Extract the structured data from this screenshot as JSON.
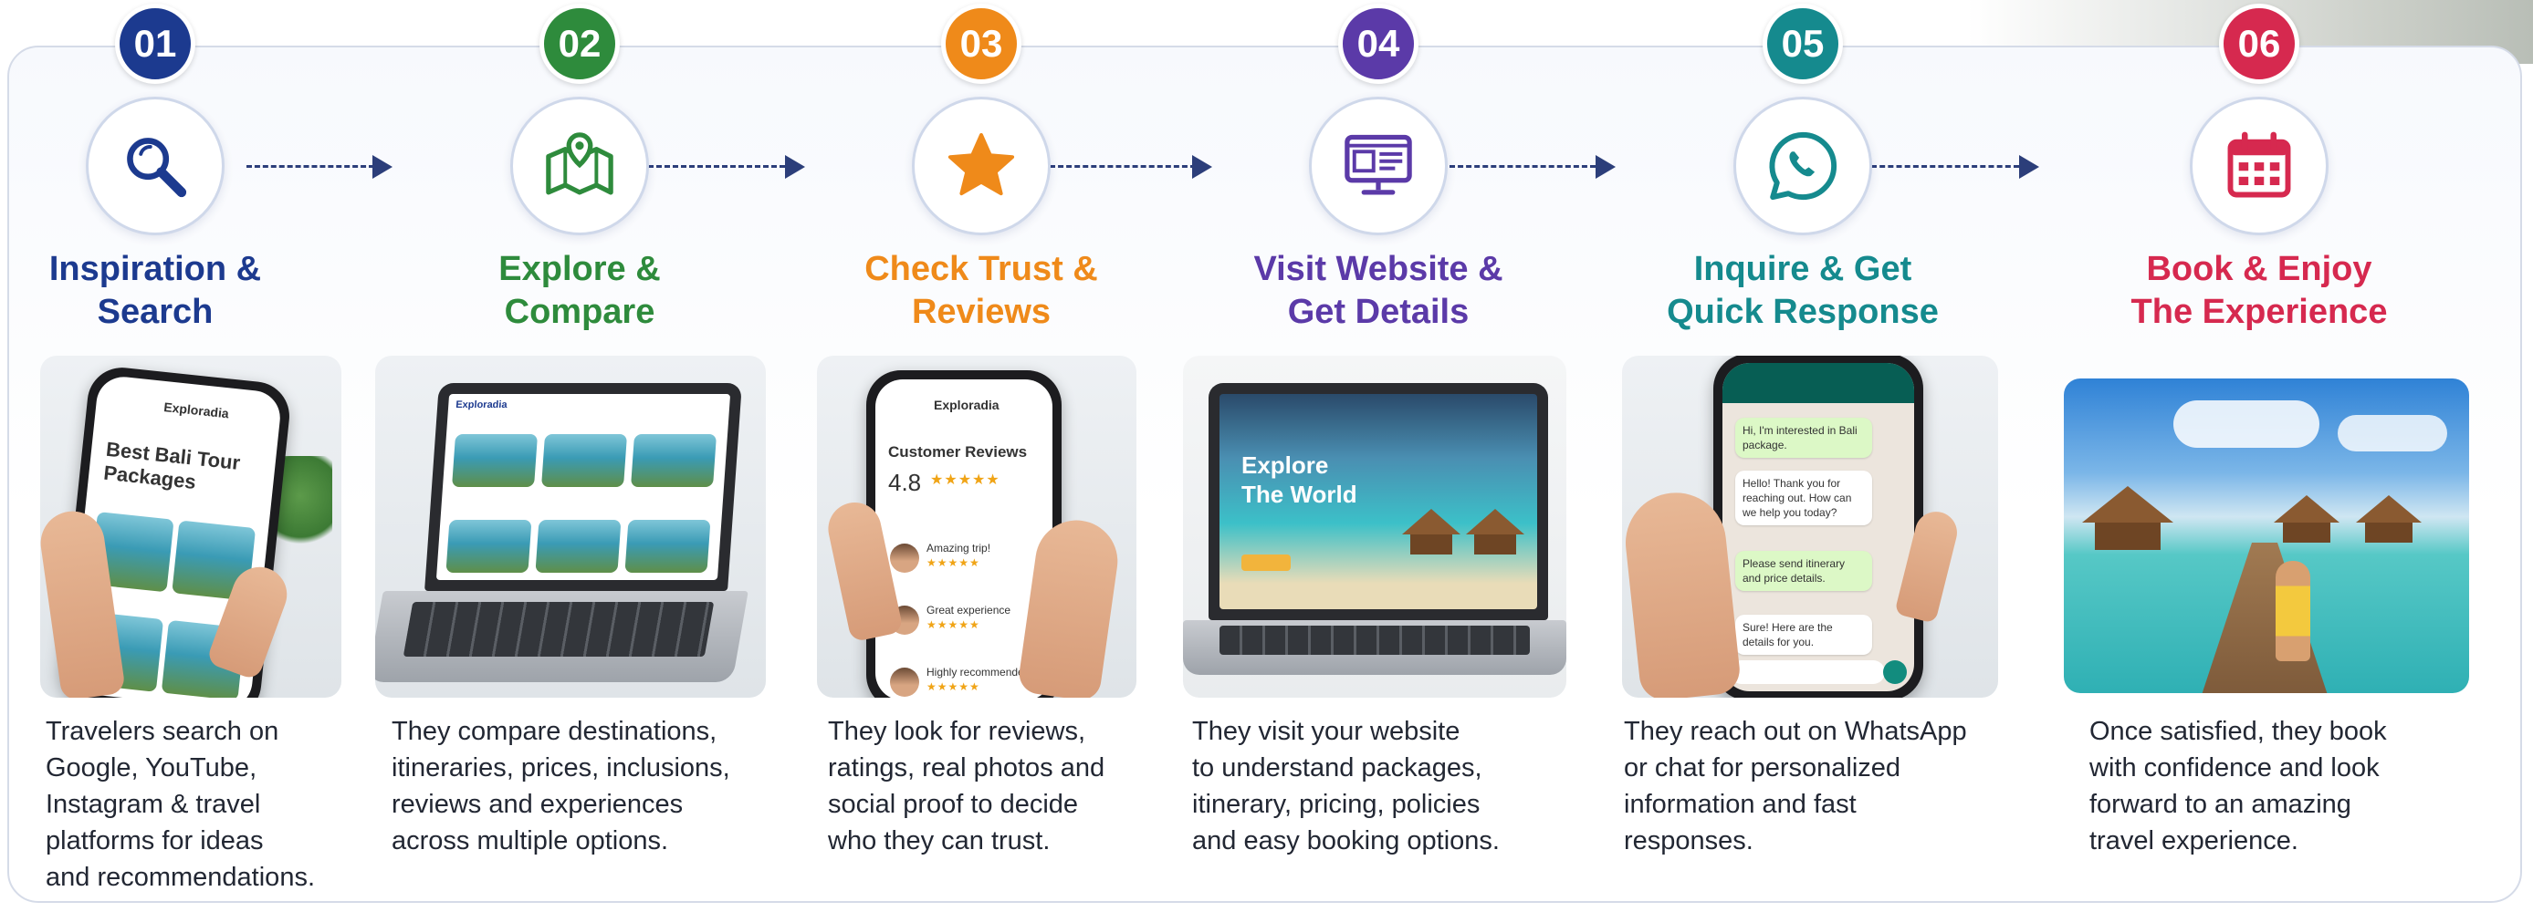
{
  "steps": [
    {
      "number": "01",
      "color": "#1c3a8f",
      "icon": "search-icon",
      "title_lines": [
        "Inspiration &",
        "Search"
      ],
      "desc_lines": [
        "Travelers search on",
        "Google, YouTube,",
        "Instagram & travel",
        "platforms for ideas",
        "and recommendations."
      ],
      "mockup": {
        "app_name": "Exploradia",
        "heading_lines": [
          "Best Bali Tour",
          "Packages"
        ]
      }
    },
    {
      "number": "02",
      "color": "#2e8b3c",
      "icon": "map-pin-icon",
      "title_lines": [
        "Explore &",
        "Compare"
      ],
      "desc_lines": [
        "They compare destinations,",
        "itineraries, prices, inclusions,",
        "reviews and experiences",
        "across multiple options."
      ],
      "mockup": {
        "app_name": "Exploradia"
      }
    },
    {
      "number": "03",
      "color": "#ef8a1a",
      "icon": "star-icon",
      "title_lines": [
        "Check Trust &",
        "Reviews"
      ],
      "desc_lines": [
        "They look for reviews,",
        "ratings, real photos and",
        "social proof to decide",
        "who they can trust."
      ],
      "mockup": {
        "app_name": "Exploradia",
        "heading": "Customer Reviews",
        "rating": "4.8",
        "reviews": [
          "Amazing trip!",
          "Great experience",
          "Highly recommended"
        ]
      }
    },
    {
      "number": "04",
      "color": "#5b3aa8",
      "icon": "website-monitor-icon",
      "title_lines": [
        "Visit Website &",
        "Get Details"
      ],
      "desc_lines": [
        "They visit your website",
        "to understand packages,",
        "itinerary, pricing, policies",
        "and easy booking options."
      ],
      "mockup": {
        "hero_lines": [
          "Explore",
          "The World"
        ]
      }
    },
    {
      "number": "05",
      "color": "#158a8e",
      "icon": "whatsapp-icon",
      "title_lines": [
        "Inquire & Get",
        "Quick Response"
      ],
      "desc_lines": [
        "They reach out on WhatsApp",
        "or chat for personalized",
        "information and fast",
        "responses."
      ],
      "mockup": {
        "messages": [
          {
            "from": "me",
            "text": "Hi, I'm interested in Bali package."
          },
          {
            "from": "them",
            "text": "Hello! Thank you for reaching out. How can we help you today?"
          },
          {
            "from": "me",
            "text": "Please send itinerary and price details."
          },
          {
            "from": "them",
            "text": "Sure! Here are the details for you."
          }
        ]
      }
    },
    {
      "number": "06",
      "color": "#d6294f",
      "icon": "calendar-icon",
      "title_lines": [
        "Book & Enjoy",
        "The Experience"
      ],
      "desc_lines": [
        "Once satisfied, they book",
        "with confidence and look",
        "forward to an amazing",
        "travel experience."
      ],
      "mockup": {}
    }
  ],
  "line_color": "#2c3e7a"
}
